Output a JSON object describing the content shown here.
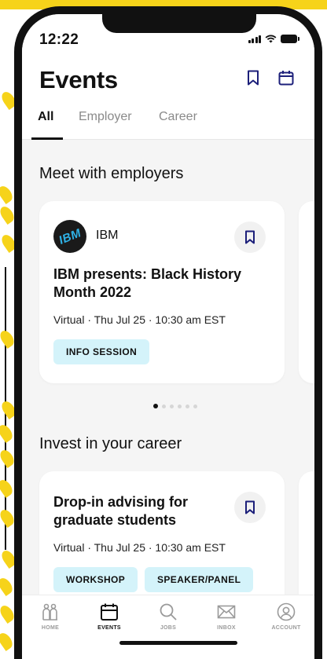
{
  "status_bar": {
    "time": "12:22"
  },
  "header": {
    "title": "Events"
  },
  "tabs": [
    {
      "label": "All",
      "active": true
    },
    {
      "label": "Employer",
      "active": false
    },
    {
      "label": "Career",
      "active": false
    }
  ],
  "sections": {
    "employers": {
      "title": "Meet with employers",
      "card": {
        "employer": "IBM",
        "logo_text": "IBM",
        "title_line1": "IBM presents: Black History",
        "title_line2": "Month 2022",
        "meta": "Virtual · Thu Jul 25 · 10:30 am EST",
        "tags": [
          "INFO SESSION"
        ]
      },
      "pager": {
        "count": 6,
        "active_index": 0
      }
    },
    "career": {
      "title": "Invest in your career",
      "card": {
        "title_line1": "Drop-in advising for",
        "title_line2": "graduate students",
        "meta": "Virtual · Thu Jul 25 · 10:30 am EST",
        "tags": [
          "WORKSHOP",
          "SPEAKER/PANEL"
        ]
      }
    }
  },
  "bottom_nav": [
    {
      "label": "HOME",
      "icon": "home-icon",
      "active": false
    },
    {
      "label": "EVENTS",
      "icon": "calendar-icon",
      "active": true
    },
    {
      "label": "JOBS",
      "icon": "search-icon",
      "active": false
    },
    {
      "label": "INBOX",
      "icon": "mail-icon",
      "active": false
    },
    {
      "label": "ACCOUNT",
      "icon": "account-icon",
      "active": false
    }
  ],
  "colors": {
    "accent": "#1c1f7a",
    "tag_bg": "#d4f3fa",
    "backdrop": "#f6d31a"
  }
}
